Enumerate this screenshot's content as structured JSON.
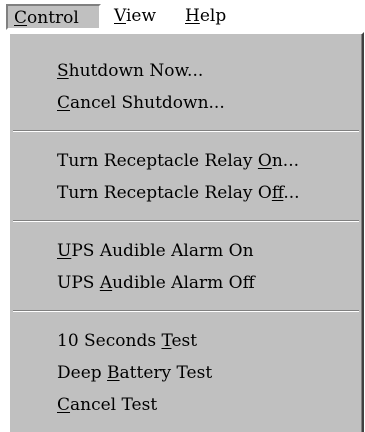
{
  "menubar": {
    "control": {
      "pre": "",
      "key": "C",
      "post": "ontrol"
    },
    "view": {
      "pre": "",
      "key": "V",
      "post": "iew"
    },
    "help": {
      "pre": "",
      "key": "H",
      "post": "elp"
    }
  },
  "menu": {
    "items": [
      {
        "pre": "",
        "key": "S",
        "post": "hutdown Now..."
      },
      {
        "pre": "",
        "key": "C",
        "post": "ancel Shutdown..."
      },
      {
        "pre": "Turn Receptacle Relay ",
        "key": "O",
        "post": "n..."
      },
      {
        "pre": "Turn Receptacle Relay O",
        "key": "f",
        "post": "f..."
      },
      {
        "pre": "",
        "key": "U",
        "post": "PS Audible Alarm On"
      },
      {
        "pre": "UPS ",
        "key": "A",
        "post": "udible Alarm Off"
      },
      {
        "pre": "10 Seconds ",
        "key": "T",
        "post": "est"
      },
      {
        "pre": "Deep ",
        "key": "B",
        "post": "attery Test"
      },
      {
        "pre": "",
        "key": "C",
        "post": "ancel Test"
      }
    ]
  }
}
